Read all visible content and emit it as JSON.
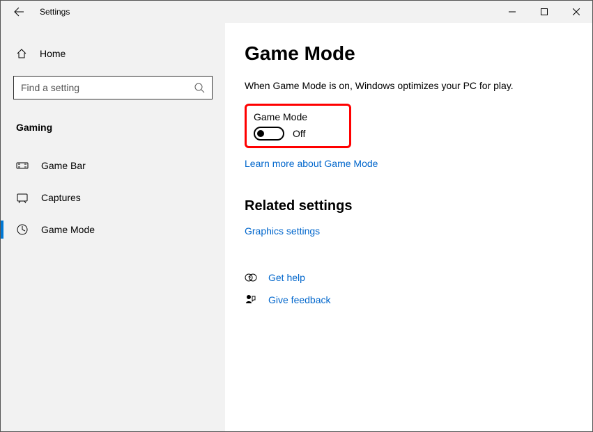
{
  "window": {
    "title": "Settings"
  },
  "sidebar": {
    "home_label": "Home",
    "search_placeholder": "Find a setting",
    "category": "Gaming",
    "items": [
      {
        "label": "Game Bar"
      },
      {
        "label": "Captures"
      },
      {
        "label": "Game Mode"
      }
    ]
  },
  "main": {
    "title": "Game Mode",
    "description": "When Game Mode is on, Windows optimizes your PC for play.",
    "toggle": {
      "label": "Game Mode",
      "state_label": "Off"
    },
    "learn_more": "Learn more about Game Mode",
    "related_title": "Related settings",
    "related_links": [
      "Graphics settings"
    ],
    "help_links": {
      "get_help": "Get help",
      "give_feedback": "Give feedback"
    }
  }
}
